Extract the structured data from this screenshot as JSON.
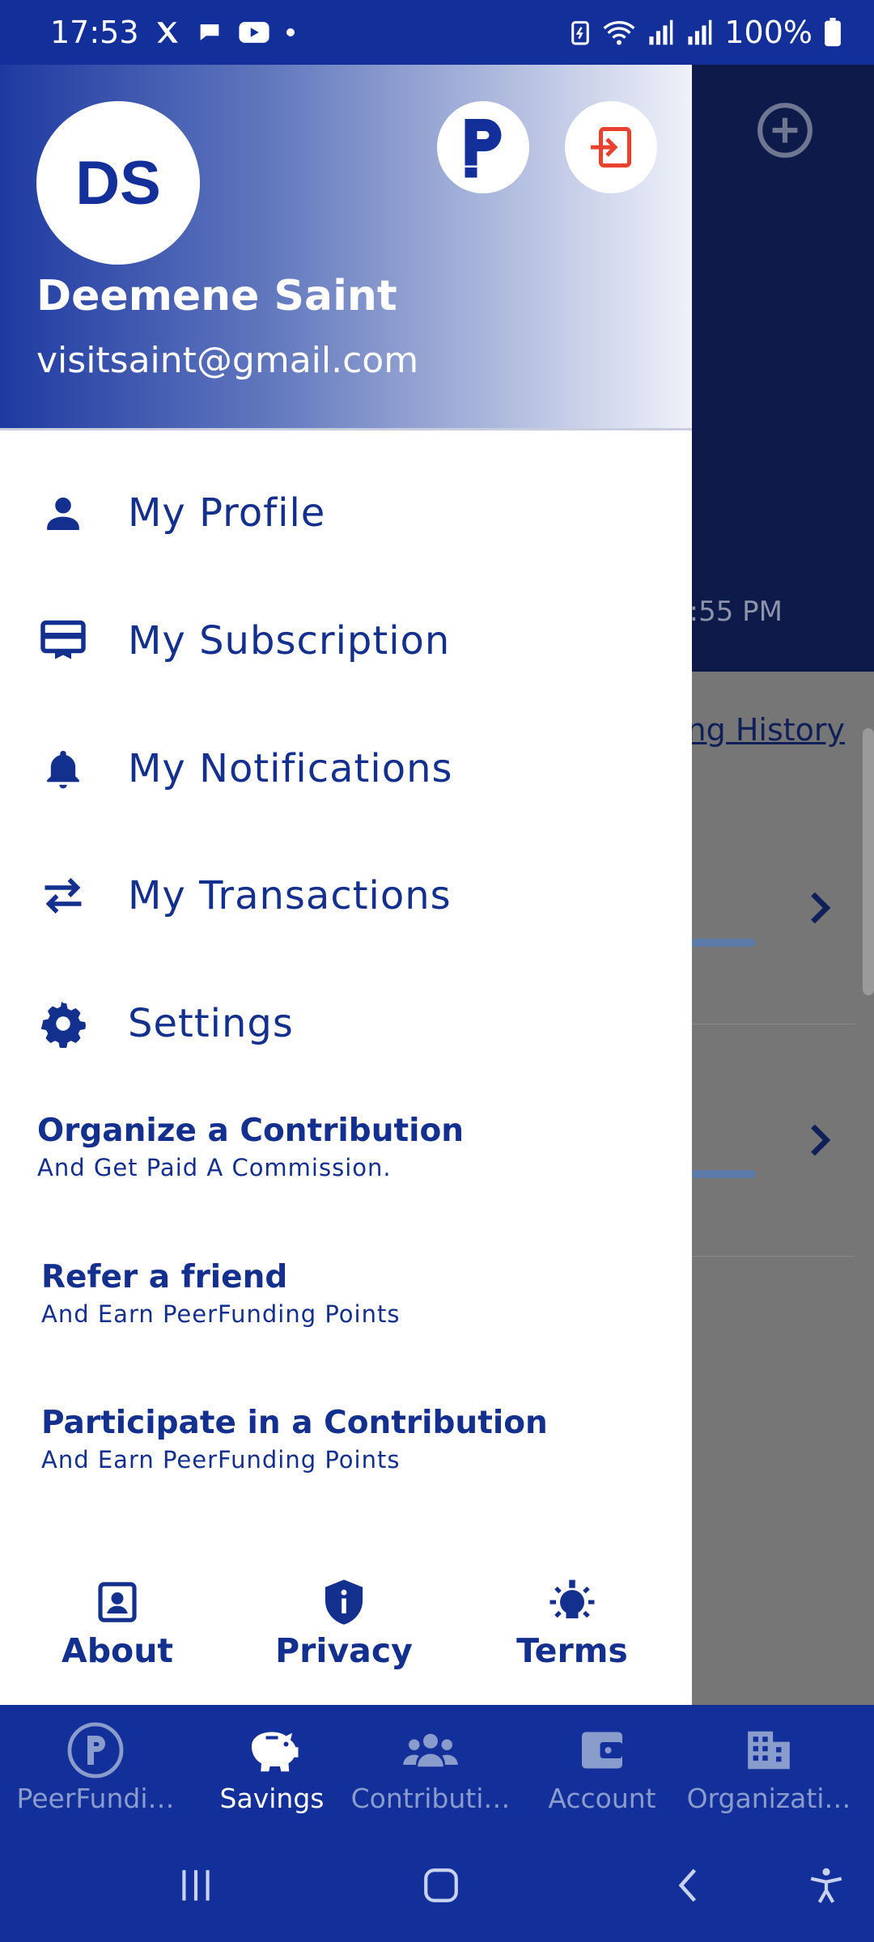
{
  "status_bar": {
    "time": "17:53",
    "battery": "100%",
    "icons": [
      "x-icon",
      "chat-icon",
      "youtube-icon",
      "dot-icon",
      "battery-saver-icon",
      "wifi-icon",
      "signal-icon",
      "signal-icon",
      "battery-icon"
    ]
  },
  "background_page": {
    "time_fragment": "5:55 PM",
    "history_link": "ing History"
  },
  "drawer": {
    "avatar_initials": "DS",
    "user_name": "Deemene Saint",
    "user_email": "visitsaint@gmail.com",
    "menu": [
      {
        "label": "My Profile",
        "icon": "person-icon"
      },
      {
        "label": "My Subscription",
        "icon": "subscription-card-icon"
      },
      {
        "label": "My Notifications",
        "icon": "bell-icon"
      },
      {
        "label": "My Transactions",
        "icon": "swap-arrows-icon"
      },
      {
        "label": "Settings",
        "icon": "gear-icon"
      }
    ],
    "promos": [
      {
        "title": "Organize a Contribution",
        "subtitle": "And Get Paid A Commission."
      },
      {
        "title": "Refer a friend",
        "subtitle": "And Earn PeerFunding Points"
      },
      {
        "title": "Participate in a Contribution",
        "subtitle": "And Earn PeerFunding Points"
      }
    ],
    "footer": [
      {
        "label": "About",
        "icon": "portrait-icon"
      },
      {
        "label": "Privacy",
        "icon": "shield-info-icon"
      },
      {
        "label": "Terms",
        "icon": "lightbulb-icon"
      }
    ]
  },
  "bottom_nav": {
    "tabs": [
      {
        "label": "PeerFundi…",
        "icon": "peerfunding-logo-icon",
        "active": false
      },
      {
        "label": "Savings",
        "icon": "piggy-bank-icon",
        "active": true
      },
      {
        "label": "Contributi…",
        "icon": "group-icon",
        "active": false
      },
      {
        "label": "Account",
        "icon": "wallet-icon",
        "active": false
      },
      {
        "label": "Organizati…",
        "icon": "building-icon",
        "active": false
      }
    ]
  },
  "colors": {
    "brand_blue": "#13309a",
    "text_blue": "#14308f",
    "logout_red": "#e8412f",
    "inactive_tab": "#8a9ccc"
  }
}
